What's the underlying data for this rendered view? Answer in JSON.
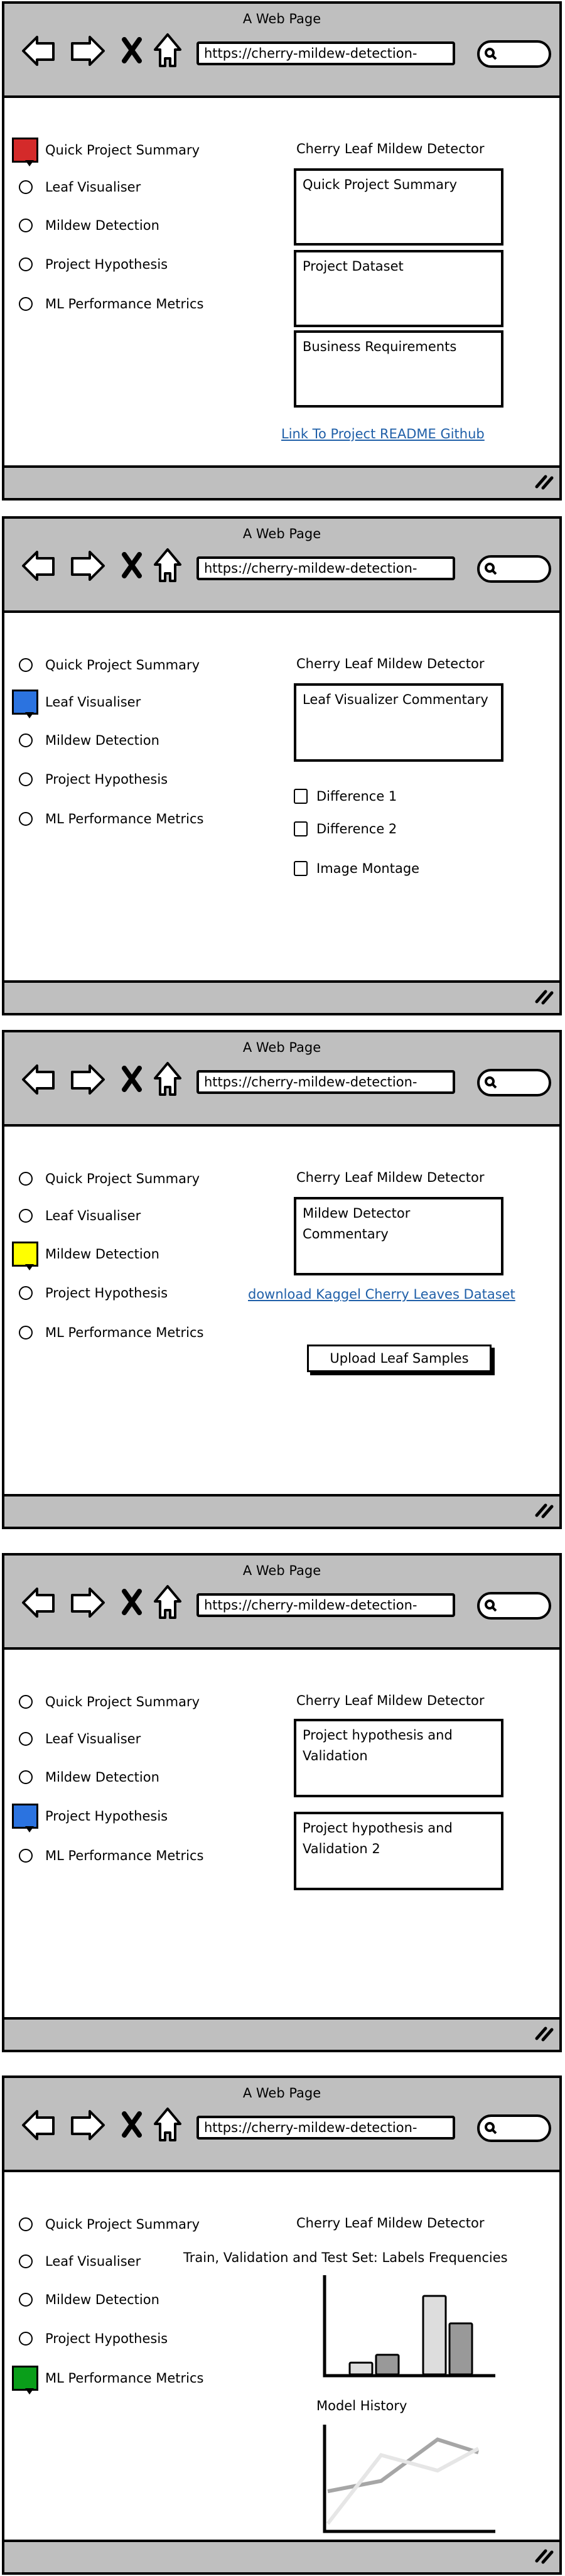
{
  "window_title": "A Web Page",
  "url": "https://cherry-mildew-detection-",
  "app_title": "Cherry Leaf Mildew Detector",
  "nav_items": [
    "Quick Project Summary",
    "Leaf Visualiser",
    "Mildew Detection",
    "Project Hypothesis",
    "ML Performance Metrics"
  ],
  "icons": [
    "back-arrow-icon",
    "forward-arrow-icon",
    "close-icon",
    "home-icon",
    "search-icon",
    "resize-handle-icon"
  ],
  "panels": [
    {
      "selected_index": 0,
      "selected_color": "#d42a2a",
      "boxes": [
        "Quick Project Summary",
        "Project Dataset",
        "Business Requirements"
      ],
      "link": "Link To Project README Github"
    },
    {
      "selected_index": 1,
      "selected_color": "#2b73e0",
      "boxes": [
        "Leaf Visualizer Commentary"
      ],
      "checkboxes": [
        "Difference 1",
        "Difference 2",
        "Image Montage"
      ]
    },
    {
      "selected_index": 2,
      "selected_color": "#ffff00",
      "boxes": [
        "Mildew Detector Commentary"
      ],
      "link": "download Kaggel Cherry Leaves Dataset",
      "button": "Upload Leaf Samples"
    },
    {
      "selected_index": 3,
      "selected_color": "#2b73e0",
      "boxes": [
        "Project hypothesis and Validation",
        "Project hypothesis and Validation 2"
      ]
    },
    {
      "selected_index": 4,
      "selected_color": "#0a9e1a",
      "charts_titles": [
        "Train, Validation and Test Set: Labels Frequencies",
        "Model History"
      ]
    }
  ],
  "chart_data": [
    {
      "type": "bar",
      "title": "Train, Validation and Test Set: Labels Frequencies",
      "values": [
        1.5,
        2.5,
        10,
        6.5
      ],
      "colors": [
        "#dddddd",
        "#999999",
        "#dddddd",
        "#999999"
      ],
      "ylim": [
        0,
        12
      ],
      "grid": false
    },
    {
      "type": "line",
      "title": "Model History",
      "x": [
        0,
        1,
        2,
        3
      ],
      "series": [
        {
          "values": [
            3,
            3.8,
            7,
            6
          ],
          "color": "#a6a6a6"
        },
        {
          "values": [
            0.5,
            5.8,
            4.6,
            6.3
          ],
          "color": "#e6e6e6"
        }
      ],
      "ylim": [
        0,
        8
      ],
      "grid": false
    }
  ]
}
